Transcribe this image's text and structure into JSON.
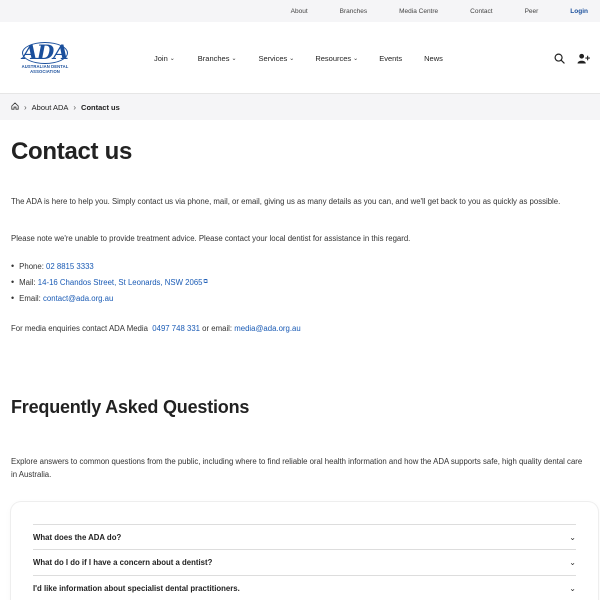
{
  "utility": {
    "links": [
      "About",
      "Branches",
      "Media Centre",
      "Contact",
      "Peer"
    ],
    "login": "Login"
  },
  "logo": {
    "mark": "ADA",
    "sub_line1": "AUSTRALIAN DENTAL",
    "sub_line2": "ASSOCIATION"
  },
  "nav": {
    "items": [
      {
        "label": "Join",
        "dropdown": true
      },
      {
        "label": "Branches",
        "dropdown": true
      },
      {
        "label": "Services",
        "dropdown": true
      },
      {
        "label": "Resources",
        "dropdown": true
      },
      {
        "label": "Events",
        "dropdown": false
      },
      {
        "label": "News",
        "dropdown": false
      }
    ]
  },
  "breadcrumb": {
    "parent": "About ADA",
    "current": "Contact us"
  },
  "page": {
    "title": "Contact us",
    "intro": "The ADA is here to help you. Simply contact us via phone, mail, or email, giving us as many details as you can, and we'll get back to you as quickly as possible.",
    "note": "Please note we're unable to provide treatment advice. Please contact your local dentist for assistance in this regard.",
    "contacts": {
      "phone_label": "Phone:",
      "phone": "02 8815 3333",
      "mail_label": "Mail:",
      "mail": "14-16 Chandos Street, St Leonards, NSW 2065",
      "email_label": "Email:",
      "email": "contact@ada.org.au"
    },
    "media": {
      "prefix": "For media enquiries contact ADA Media",
      "phone": "0497 748 331",
      "middle": "or email:",
      "email": "media@ada.org.au"
    }
  },
  "faq": {
    "title": "Frequently Asked Questions",
    "intro": "Explore answers to common questions from the public, including where to find reliable oral health information and how the ADA supports safe, high quality dental care in Australia.",
    "items": [
      "What does the ADA do?",
      "What do I do if I have a concern about a dentist?",
      "I'd like information about specialist dental practitioners."
    ]
  },
  "colors": {
    "brand": "#1a4f9c",
    "link": "#1a5bb5"
  }
}
